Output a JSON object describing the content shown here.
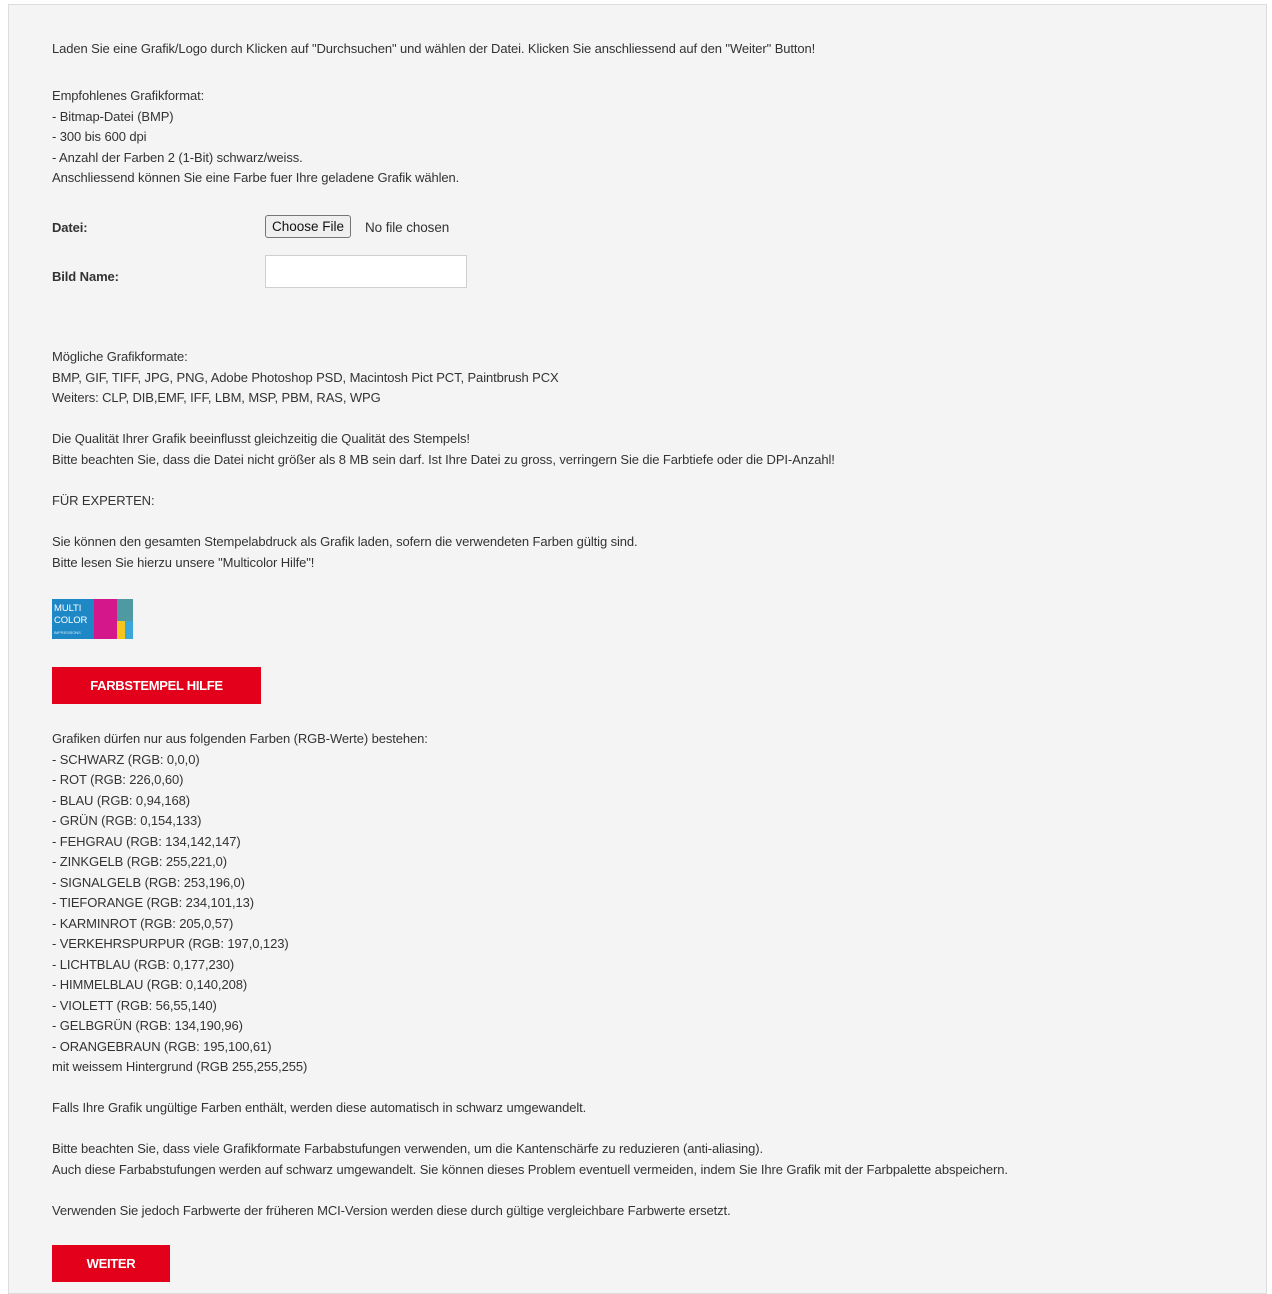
{
  "intro": {
    "instruction": "Laden Sie eine Grafik/Logo durch Klicken auf \"Durchsuchen\" und wählen der Datei. Klicken Sie anschliessend auf den \"Weiter\" Button!",
    "format_lines": [
      "Empfohlenes Grafikformat:",
      "- Bitmap-Datei (BMP)",
      "- 300 bis 600 dpi",
      "- Anzahl der Farben 2 (1-Bit) schwarz/weiss.",
      "Anschliessend können Sie eine Farbe fuer Ihre geladene Grafik wählen."
    ]
  },
  "form": {
    "file_label": "Datei:",
    "file_button": "Choose File",
    "file_status": "No file chosen",
    "name_label": "Bild Name:",
    "name_value": ""
  },
  "formats": {
    "lines": [
      "Mögliche Grafikformate:",
      "BMP, GIF, TIFF, JPG, PNG, Adobe Photoshop PSD, Macintosh Pict PCT, Paintbrush PCX",
      "Weiters: CLP, DIB,EMF, IFF, LBM, MSP, PBM, RAS, WPG"
    ]
  },
  "quality": {
    "lines": [
      "Die Qualität Ihrer Grafik beeinflusst gleichzeitig die Qualität des Stempels!",
      "Bitte beachten Sie, dass die Datei nicht größer als 8 MB sein darf. Ist Ihre Datei zu gross, verringern Sie die Farbtiefe oder die DPI-Anzahl!"
    ]
  },
  "experts": {
    "heading": "FÜR EXPERTEN:",
    "lines": [
      "Sie können den gesamten Stempelabdruck als Grafik laden, sofern die verwendeten Farben gültig sind.",
      "Bitte lesen Sie hierzu unsere \"Multicolor Hilfe\"!"
    ]
  },
  "logo": {
    "text_top": "MULTI",
    "text_bottom": "COLOR",
    "text_small": "IMPRESSIONS",
    "colors": {
      "blue": "#1e88c7",
      "magenta": "#d4178a",
      "teal": "#4f9aa2",
      "yellow": "#f2c61c",
      "cyan": "#3aa7dc"
    }
  },
  "help_button": {
    "label": "FARBSTEMPEL HILFE"
  },
  "colors_list": {
    "intro": "Grafiken dürfen nur aus folgenden Farben (RGB-Werte) bestehen:",
    "items": [
      " - SCHWARZ (RGB: 0,0,0)",
      " - ROT (RGB: 226,0,60)",
      " - BLAU (RGB: 0,94,168)",
      " - GRÜN (RGB: 0,154,133)",
      " - FEHGRAU (RGB: 134,142,147)",
      " - ZINKGELB (RGB: 255,221,0)",
      " - SIGNALGELB (RGB: 253,196,0)",
      " - TIEFORANGE (RGB: 234,101,13)",
      " - KARMINROT (RGB: 205,0,57)",
      " - VERKEHRSPURPUR (RGB: 197,0,123)",
      " - LICHTBLAU (RGB: 0,177,230)",
      " - HIMMELBLAU (RGB: 0,140,208)",
      " - VIOLETT (RGB: 56,55,140)",
      " - GELBGRÜN (RGB: 134,190,96)",
      " - ORANGEBRAUN (RGB: 195,100,61)"
    ],
    "background": "mit weissem Hintergrund (RGB 255,255,255)"
  },
  "notes": {
    "invalid": "Falls Ihre Grafik ungültige Farben enthält, werden diese automatisch in schwarz umgewandelt.",
    "antialias": [
      "Bitte beachten Sie, dass viele Grafikformate Farbabstufungen verwenden, um die Kantenschärfe zu reduzieren (anti-aliasing).",
      "Auch diese Farbabstufungen werden auf schwarz umgewandelt. Sie können dieses Problem eventuell vermeiden, indem Sie Ihre Grafik mit der Farbpalette abspeichern."
    ],
    "mci": "Verwenden Sie jedoch Farbwerte der früheren MCI-Version werden diese durch gültige vergleichbare Farbwerte ersetzt."
  },
  "next_button": {
    "label": "WEITER"
  }
}
